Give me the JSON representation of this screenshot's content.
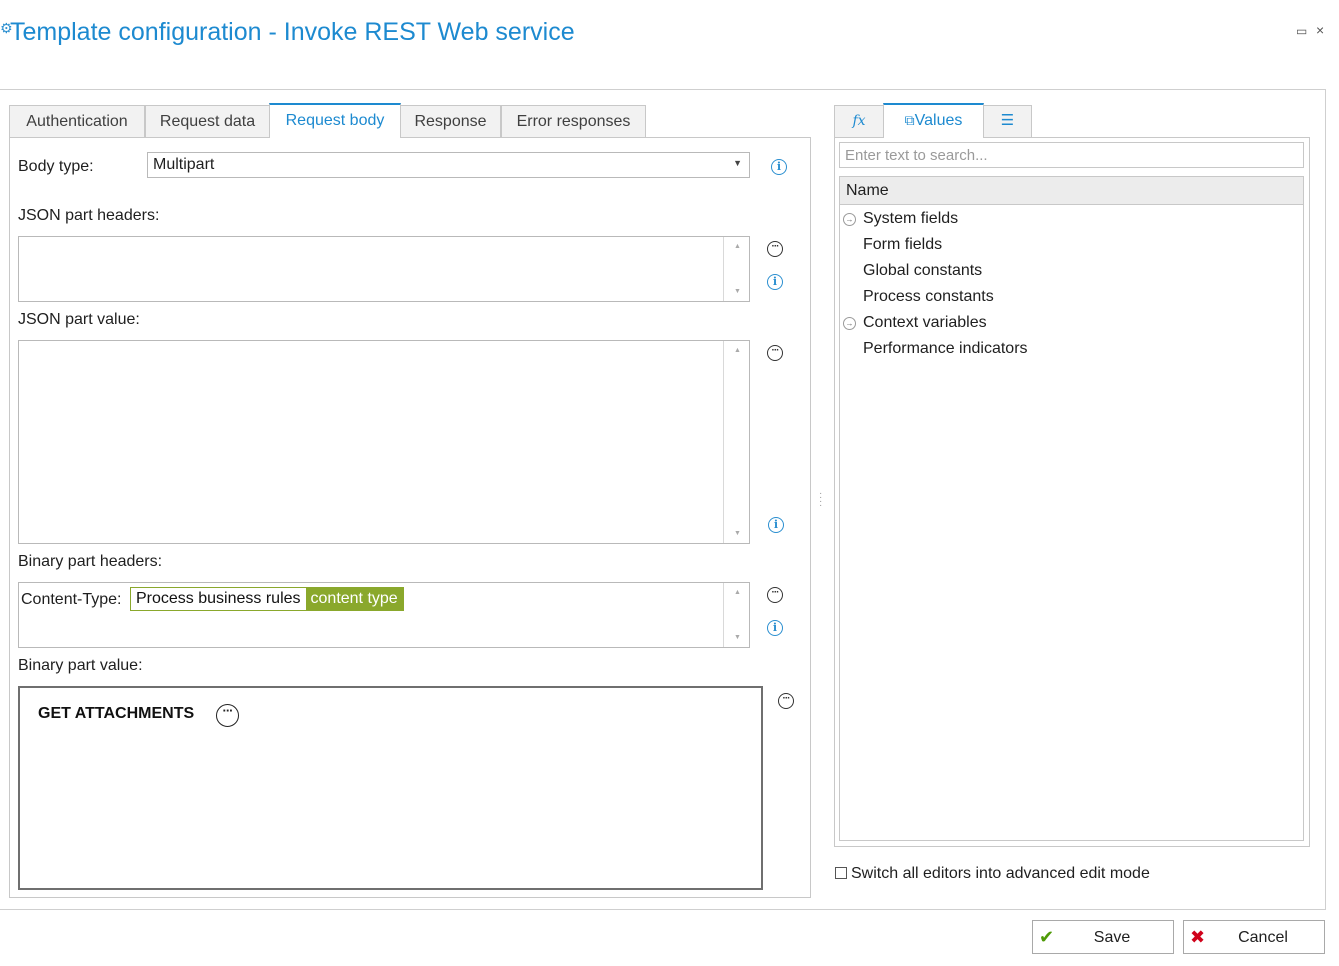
{
  "window": {
    "title": "Template configuration - Invoke REST Web service",
    "maximize_glyph": "▭",
    "close_glyph": "×"
  },
  "tabs": [
    {
      "label": "Authentication"
    },
    {
      "label": "Request data"
    },
    {
      "label": "Request body",
      "active": true
    },
    {
      "label": "Response"
    },
    {
      "label": "Error responses"
    }
  ],
  "form": {
    "body_type_label": "Body type:",
    "body_type_value": "Multipart",
    "json_headers_label": "JSON part headers:",
    "json_value_label": "JSON part value:",
    "binary_headers_label": "Binary part headers:",
    "binary_headers_key": "Content-Type:",
    "binary_headers_token_source": "Process business rules",
    "binary_headers_token_name": "content type",
    "binary_value_label": "Binary part value:",
    "binary_value_function": "GET ATTACHMENTS"
  },
  "right_tabs": {
    "fx_glyph": "𝑓x",
    "values_label": "Values",
    "list_glyph": "☰"
  },
  "search": {
    "placeholder": "Enter text to search..."
  },
  "tree": {
    "header": "Name",
    "items": [
      {
        "label": "System fields",
        "expandable": true
      },
      {
        "label": "Form fields",
        "expandable": false
      },
      {
        "label": "Global constants",
        "expandable": false
      },
      {
        "label": "Process constants",
        "expandable": false
      },
      {
        "label": "Context variables",
        "expandable": true
      },
      {
        "label": "Performance indicators",
        "expandable": false
      }
    ]
  },
  "advanced_mode_label": "Switch all editors into advanced edit mode",
  "buttons": {
    "save": "Save",
    "cancel": "Cancel"
  },
  "colors": {
    "accent": "#1d8ad0",
    "token_green": "#8aa82c",
    "save_icon": "#4e9a06",
    "cancel_icon": "#d0021b"
  }
}
